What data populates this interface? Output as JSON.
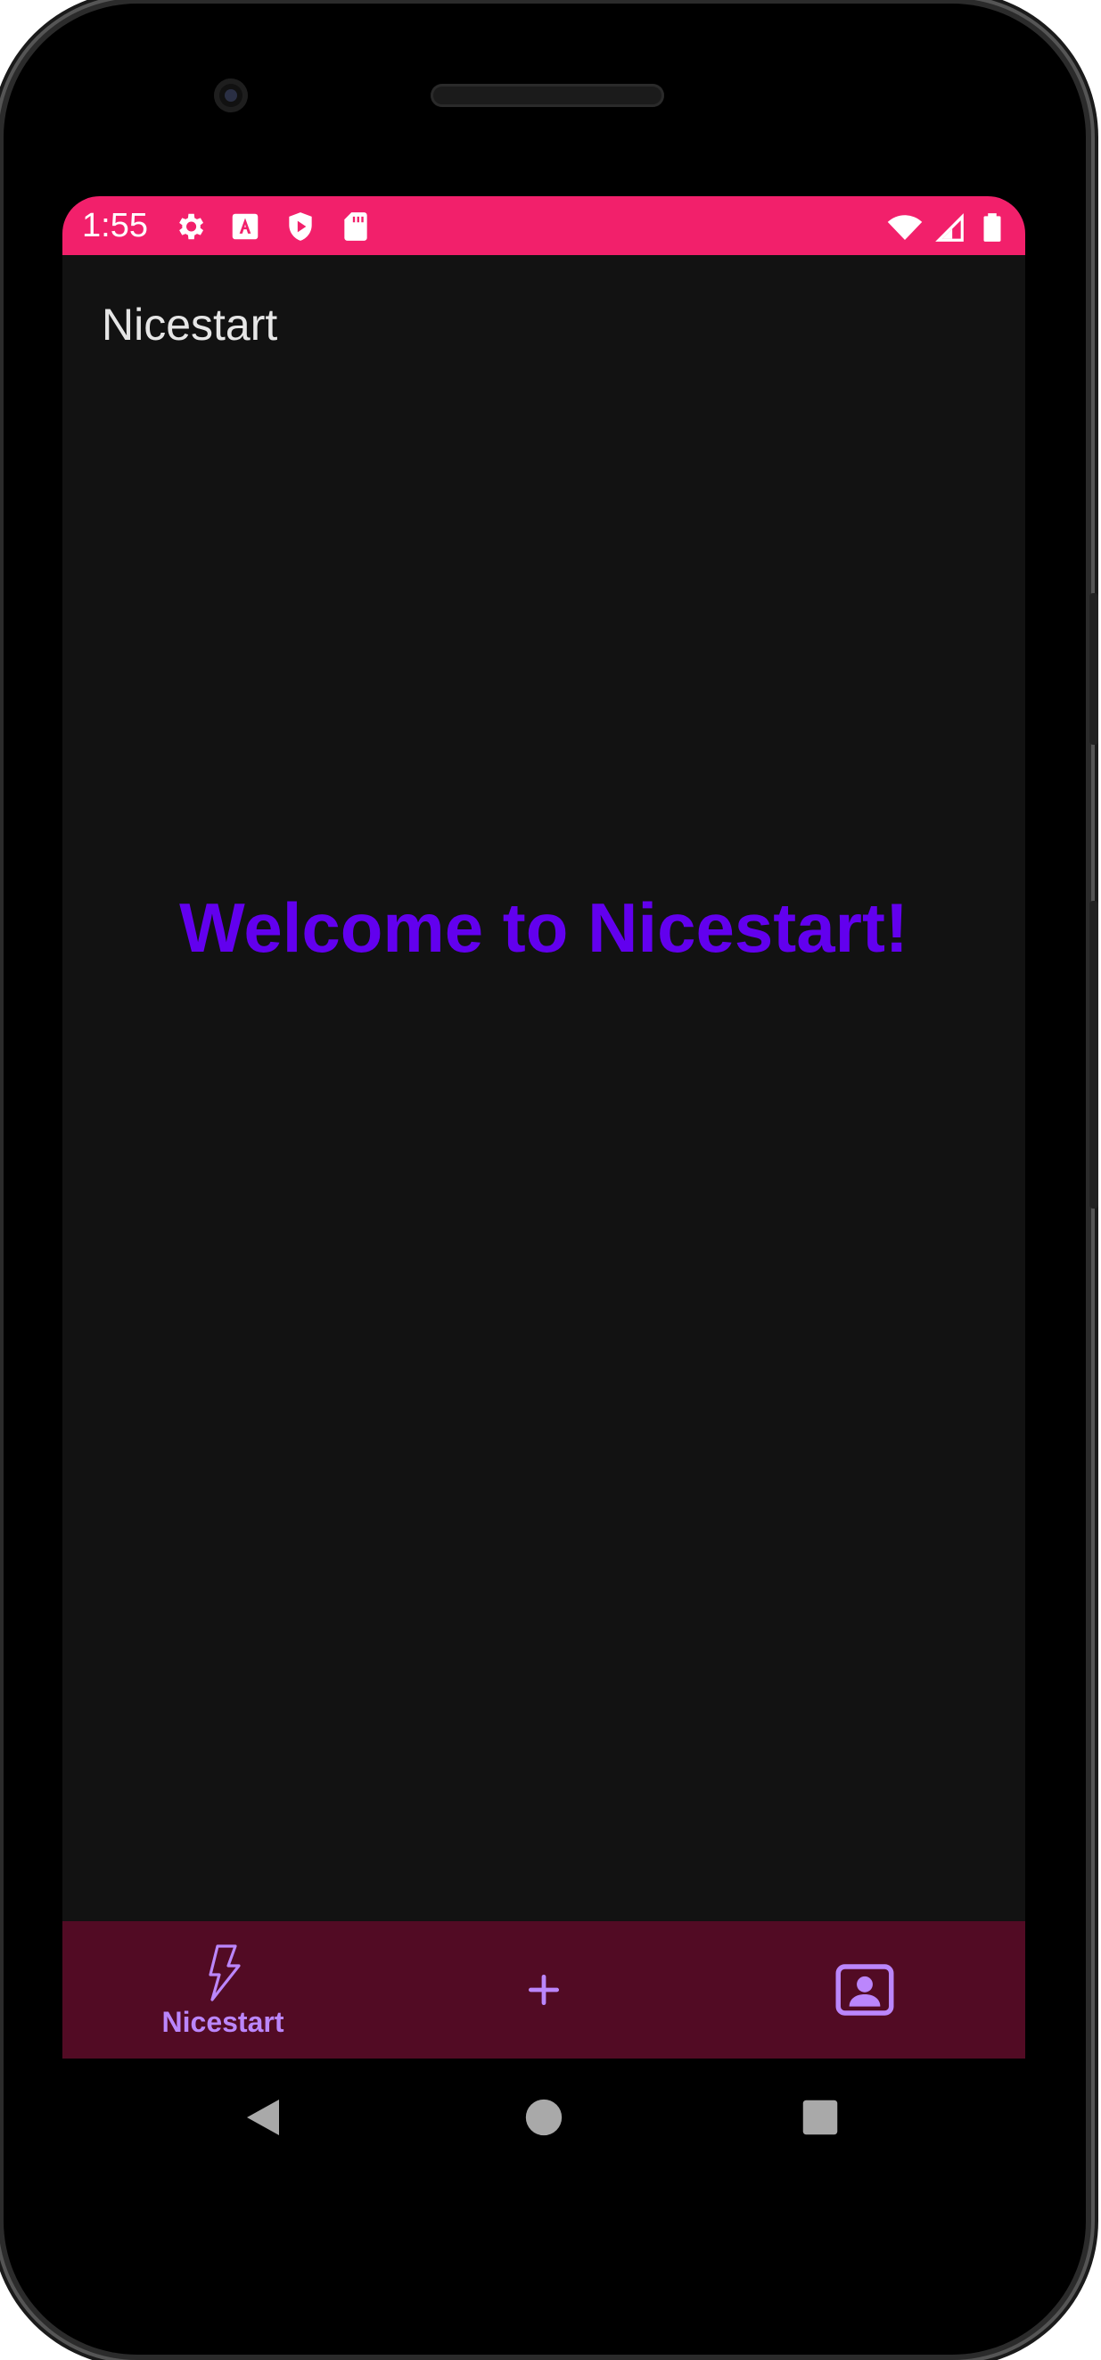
{
  "status_bar": {
    "time": "1:55",
    "left_icons": [
      "gear-icon",
      "a-icon",
      "shield-play-icon",
      "sd-card-icon"
    ],
    "right_icons": [
      "wifi-icon",
      "signal-icon",
      "battery-icon"
    ],
    "color": "#f2206b"
  },
  "app_bar": {
    "title": "Nicestart"
  },
  "main": {
    "welcome_text": "Welcome to Nicestart!",
    "welcome_color": "#6200ee",
    "background": "#121212"
  },
  "bottom_nav": {
    "background": "#520b24",
    "accent": "#bb86fc",
    "items": [
      {
        "label": "Nicestart",
        "icon": "bolt-icon",
        "selected": true
      },
      {
        "label": "",
        "icon": "plus-icon",
        "selected": false
      },
      {
        "label": "",
        "icon": "contact-card-icon",
        "selected": false
      }
    ]
  },
  "system_nav": {
    "buttons": [
      "back-icon",
      "home-icon",
      "recents-icon"
    ]
  }
}
